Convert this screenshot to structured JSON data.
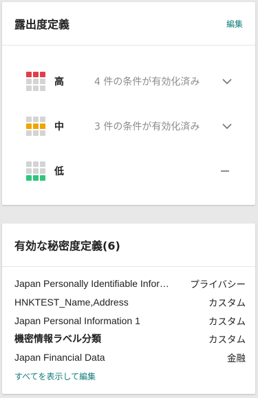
{
  "exposure_card": {
    "title": "露出度定義",
    "edit_label": "編集",
    "levels": [
      {
        "label": "高",
        "status": "4 件の条件が有効化済み",
        "color": "#e03e4b",
        "filled_row": "top",
        "control": "chevron-down-icon"
      },
      {
        "label": "中",
        "status": "3 件の条件が有効化済み",
        "color": "#f0a500",
        "filled_row": "middle",
        "control": "chevron-down-icon"
      },
      {
        "label": "低",
        "status": "",
        "color": "#2ec57c",
        "filled_row": "bottom",
        "control": "minus-icon"
      }
    ],
    "grid_empty_color": "#d4d4d4"
  },
  "sensitivity_card": {
    "title": "有効な秘密度定義(6)",
    "items": [
      {
        "name": "Japan Personally Identifiable Information",
        "type": "プライバシー",
        "bold": false
      },
      {
        "name": "HNKTEST_Name,Address",
        "type": "カスタム",
        "bold": false
      },
      {
        "name": "Japan Personal Information 1",
        "type": "カスタム",
        "bold": false
      },
      {
        "name": "機密情報ラベル分類",
        "type": "カスタム",
        "bold": true
      },
      {
        "name": "Japan Financial Data",
        "type": "金融",
        "bold": false
      }
    ],
    "view_all_label": "すべてを表示して編集"
  },
  "colors": {
    "accent": "#117d7b",
    "background": "#e8e8e8",
    "muted_text": "#8c8c8c"
  }
}
